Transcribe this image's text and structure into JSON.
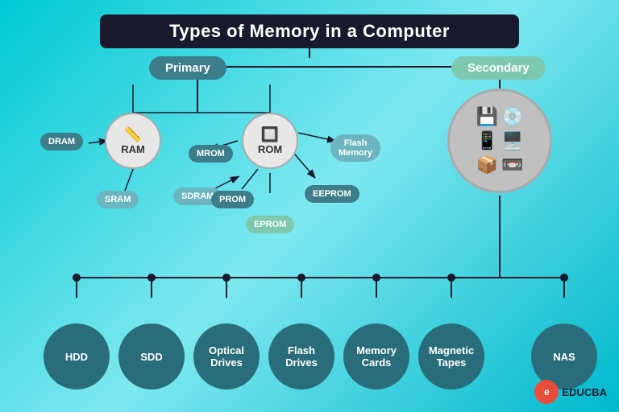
{
  "title": "Types of Memory in a Computer",
  "categories": {
    "primary": "Primary",
    "secondary": "Secondary"
  },
  "primary_memory": {
    "ram": {
      "label": "RAM",
      "subtypes": [
        "DRAM",
        "SRAM",
        "SDRAM"
      ]
    },
    "rom": {
      "label": "ROM",
      "subtypes": [
        "MROM",
        "PROM",
        "EPROM",
        "EEPROM",
        "Flash Memory"
      ]
    }
  },
  "secondary_memory": {
    "types": [
      "HDD",
      "SDD",
      "Optical Drives",
      "Flash Drives",
      "Memory Cards",
      "Magnetic Tapes",
      "NAS"
    ]
  },
  "logo": {
    "symbol": "e",
    "text": "EDUCBA"
  }
}
